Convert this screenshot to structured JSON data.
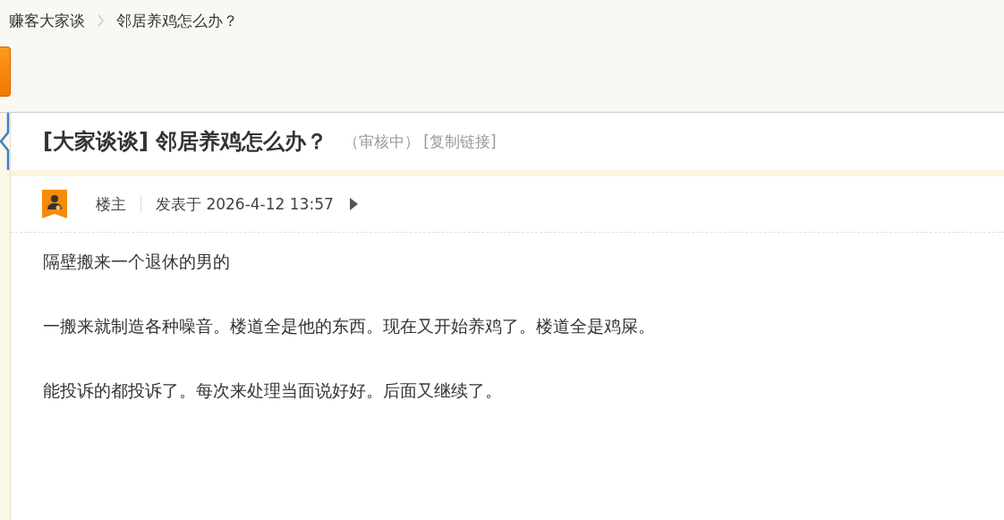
{
  "breadcrumb": [
    {
      "label": "赚客大家谈"
    },
    {
      "label": "邻居养鸡怎么办？"
    }
  ],
  "thread": {
    "prefix": "[大家谈谈]",
    "title": "邻居养鸡怎么办？",
    "status": "（审核中）",
    "copy_link": "[复制链接]"
  },
  "post": {
    "author_label": "楼主",
    "posted": "发表于 2026-4-12 13:57",
    "paragraphs": [
      "隔壁搬来一个退休的男的",
      "一搬来就制造各种噪音。楼道全是他的东西。现在又开始养鸡了。楼道全是鸡屎。",
      "能投诉的都投诉了。每次来处理当面说好好。后面又继续了。"
    ]
  }
}
